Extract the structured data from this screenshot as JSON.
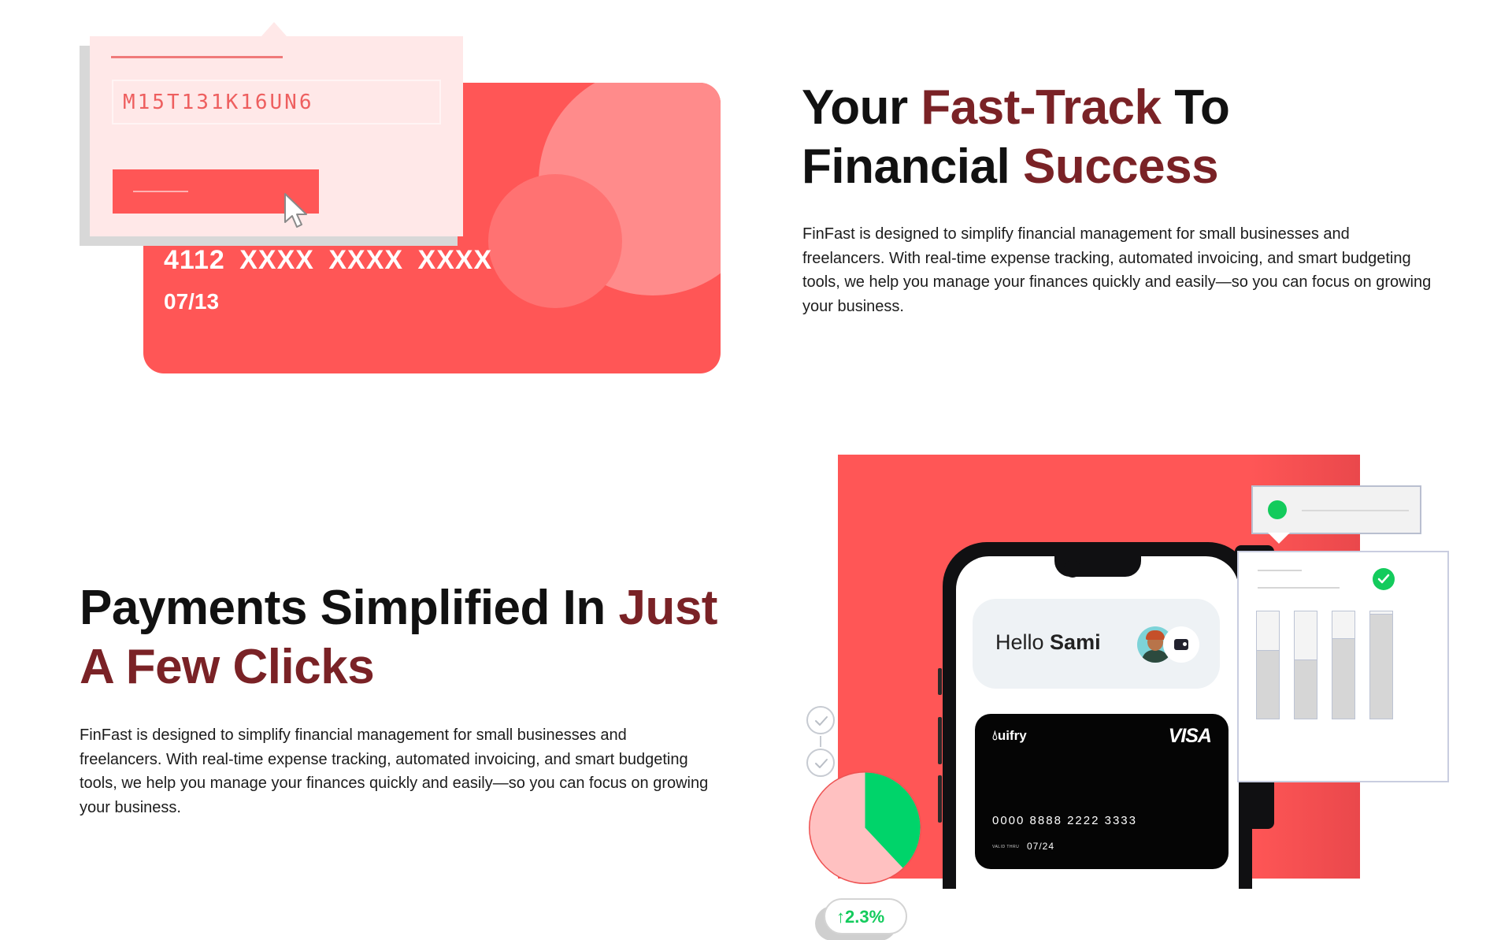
{
  "section_one": {
    "title_parts": [
      "Your ",
      "Fast-Track",
      " To",
      "Financial ",
      "Success"
    ],
    "description": "FinFast is designed to simplify financial management for small businesses and freelancers. With real-time expense tracking, automated invoicing, and smart budgeting tools, we help you manage your finances quickly and easily—so you can focus on growing your business.",
    "illustration": {
      "promo_code": "M15T131K16UN6",
      "card_number": "4112 XXXX XXXX XXXX",
      "card_expiry": "07/13",
      "card_color": "#ff5656",
      "popup_color": "#ffe8e8"
    }
  },
  "section_two": {
    "title_parts": [
      "Payments Simplified In ",
      "Just",
      "A Few Clicks"
    ],
    "description": "FinFast is designed to simplify financial management for small businesses and freelancers. With real-time expense tracking, automated invoicing, and smart budgeting tools, we help you manage your finances quickly and easily—so you can focus on growing your business.",
    "illustration": {
      "greeting": "Hello",
      "user_name": "Sami",
      "card_brand": "uifry",
      "card_network": "VISA",
      "card_number": "0000 8888 2222 3333",
      "valid_thru_label": "VALID THRU",
      "card_expiry": "07/24",
      "growth_badge": "↑2.3%",
      "pie_share": 0.38,
      "bar_fill_levels": [
        0.64,
        0.55,
        0.75,
        0.98
      ],
      "accent_color": "#7a2226",
      "success_color": "#13cb5c"
    }
  }
}
